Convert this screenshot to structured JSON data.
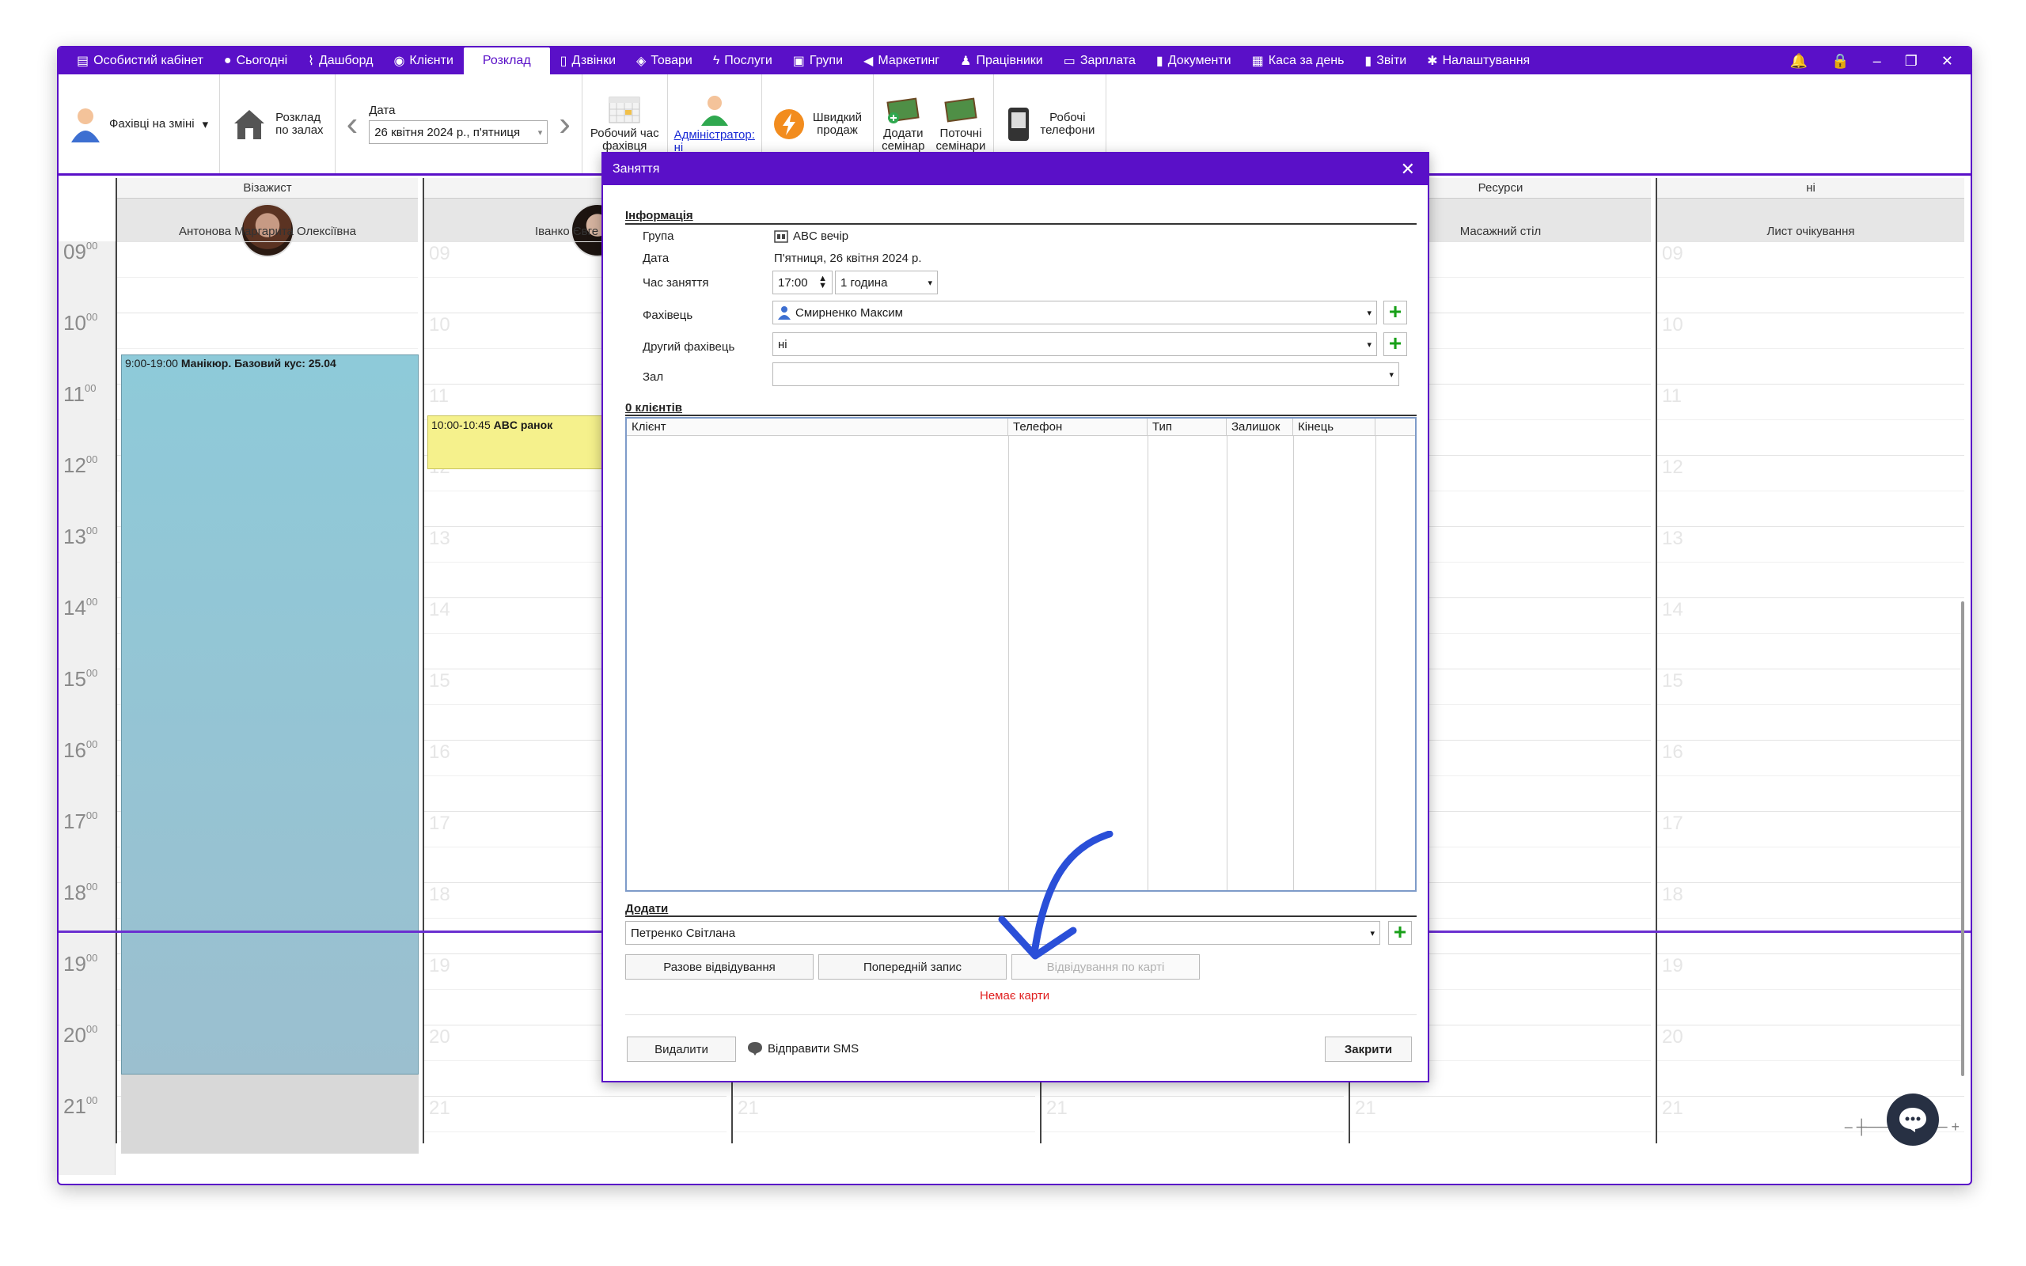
{
  "menu": {
    "items": [
      {
        "label": "Особистий кабінет",
        "icon": "briefcase-icon"
      },
      {
        "label": "Сьогодні",
        "icon": "today-icon"
      },
      {
        "label": "Дашборд",
        "icon": "pulse-icon"
      },
      {
        "label": "Клієнти",
        "icon": "user-circle-icon"
      },
      {
        "label": "Розклад",
        "icon": "",
        "active": true
      },
      {
        "label": "Дзвінки",
        "icon": "phone-icon"
      },
      {
        "label": "Товари",
        "icon": "box-icon"
      },
      {
        "label": "Послуги",
        "icon": "lightning-icon"
      },
      {
        "label": "Групи",
        "icon": "group-icon"
      },
      {
        "label": "Маркетинг",
        "icon": "megaphone-icon"
      },
      {
        "label": "Працівники",
        "icon": "person-icon"
      },
      {
        "label": "Зарплата",
        "icon": "money-icon"
      },
      {
        "label": "Документи",
        "icon": "document-icon"
      },
      {
        "label": "Каса за день",
        "icon": "calculator-icon"
      },
      {
        "label": "Звіти",
        "icon": "bar-chart-icon"
      },
      {
        "label": "Налаштування",
        "icon": "gear-icon"
      }
    ]
  },
  "toolbar": {
    "staff_on_shift": "Фахівці на зміні",
    "schedule_by_rooms_1": "Розклад",
    "schedule_by_rooms_2": "по залах",
    "date_label": "Дата",
    "date_value": "26 квітня 2024 р., п'ятниця",
    "work_time_1": "Робочий час",
    "work_time_2": "фахівця",
    "admin_1": "Адміністратор:",
    "admin_2": "ні",
    "quick_sale_1": "Швидкий",
    "quick_sale_2": "продаж",
    "add_seminar_1": "Додати",
    "add_seminar_2": "семінар",
    "current_seminars_1": "Поточні",
    "current_seminars_2": "семінари",
    "work_phones_1": "Робочі",
    "work_phones_2": "телефони"
  },
  "grid": {
    "columns": [
      {
        "head": "Візажист",
        "name": "Антонова Маргарита Олексіївна"
      },
      {
        "head": "",
        "name": "Іванко Євге"
      },
      {
        "head": "Ресурси",
        "name": "Масажний стіл"
      },
      {
        "head": "ні",
        "name": "Лист очікування"
      }
    ],
    "times": [
      "09",
      "10",
      "11",
      "12",
      "13",
      "14",
      "15",
      "16",
      "17",
      "18",
      "19",
      "20",
      "21"
    ],
    "ghost_times": [
      "09",
      "10",
      "11",
      "12",
      "13",
      "14",
      "15",
      "16",
      "17",
      "18",
      "19",
      "20",
      "21"
    ],
    "appointments": [
      {
        "time": "9:00-19:00",
        "title": "Манікюр. Базовий кус: 25.04"
      },
      {
        "time": "10:00-10:45",
        "title": "ABC ранок"
      }
    ],
    "minutes_suffix": "00"
  },
  "modal": {
    "title": "Заняття",
    "info_section": "Інформація",
    "group_label": "Група",
    "group_value": "ABC вечір",
    "date_label": "Дата",
    "date_value": "П'ятниця, 26 квітня 2024 р.",
    "time_label": "Час заняття",
    "time_value": "17:00",
    "duration_value": "1 година",
    "specialist_label": "Фахівець",
    "specialist_value": "Смирненко Максим",
    "second_specialist_label": "Другий фахівець",
    "second_specialist_value": "ні",
    "hall_label": "Зал",
    "hall_value": "",
    "clients_section": "0 клієнтів",
    "table_headers": [
      "Клієнт",
      "Телефон",
      "Тип",
      "Залишок",
      "Кінець"
    ],
    "add_section": "Додати",
    "add_client_value": "Петренко Світлана",
    "btn_single_visit": "Разове відвідування",
    "btn_pre_booking": "Попередній запис",
    "btn_card_visit": "Відвідування по карті",
    "no_card_message": "Немає карти",
    "btn_delete": "Видалити",
    "btn_send_sms": "Відправити SMS",
    "btn_close": "Закрити"
  },
  "colors": {
    "accent": "#5a10c8",
    "appointment_blue": "#8ecad9",
    "appointment_yellow": "#f5f18c",
    "error": "#e02020",
    "add_green": "#18a018",
    "annotation_arrow": "#2a4fd8"
  }
}
